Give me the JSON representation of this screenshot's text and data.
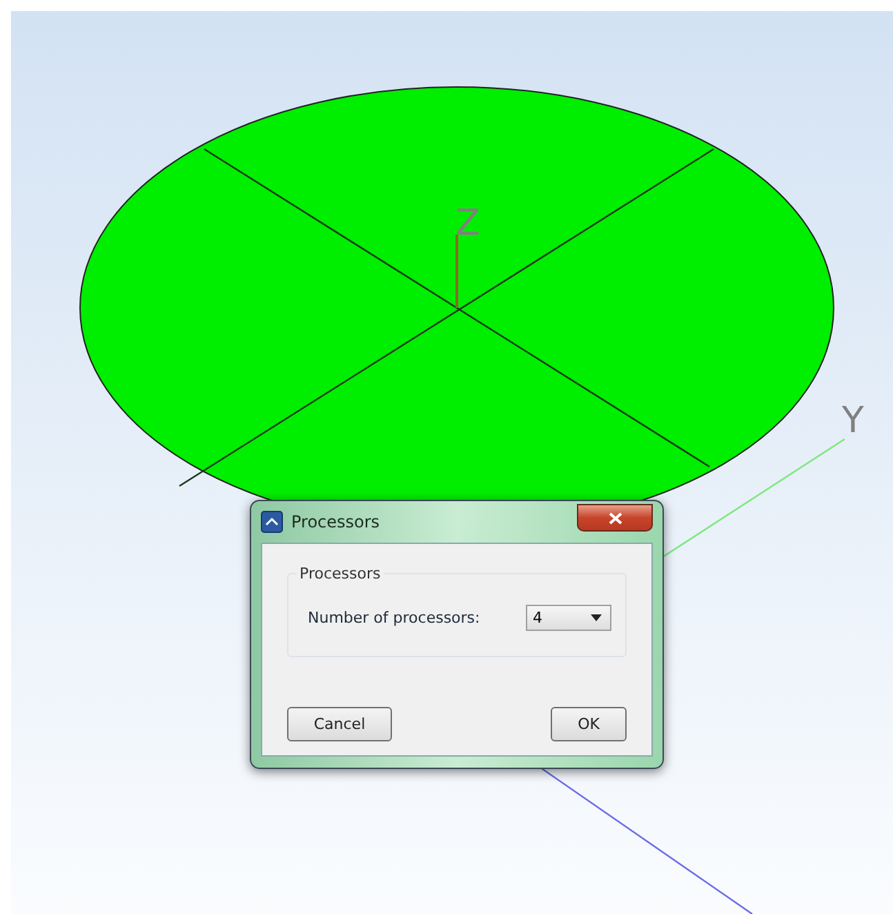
{
  "viewport": {
    "axes": [
      {
        "label": "Z"
      },
      {
        "label": "Y"
      }
    ]
  },
  "dialog": {
    "title": "Processors",
    "group": {
      "label": "Processors",
      "field_label": "Number of processors:",
      "value": "4"
    },
    "buttons": [
      "Cancel",
      "OK"
    ]
  }
}
